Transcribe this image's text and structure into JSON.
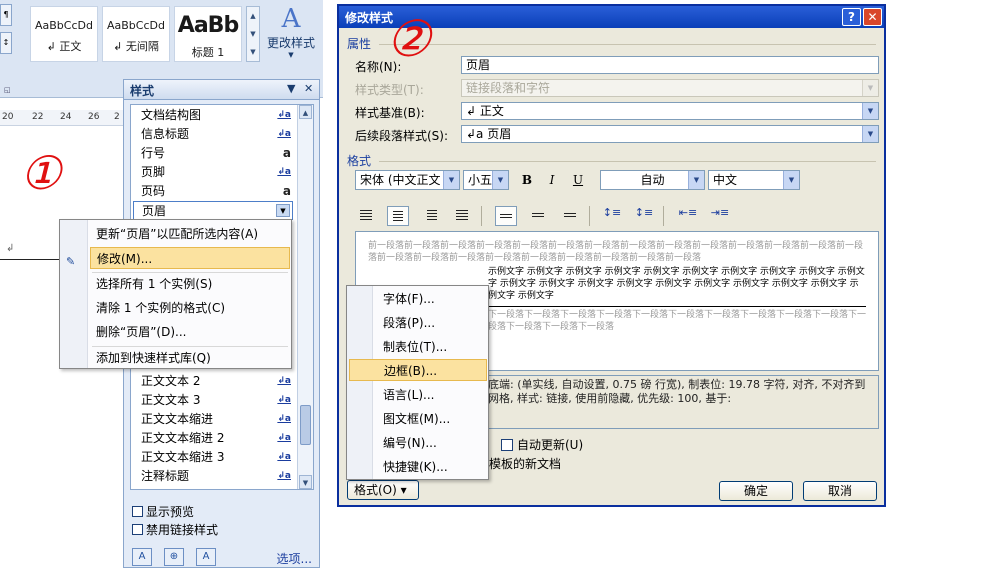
{
  "ribbon": {
    "gallery": [
      {
        "sample": "AaBbCcDd",
        "name": "↲ 正文"
      },
      {
        "sample": "AaBbCcDd",
        "name": "↲ 无间隔"
      },
      {
        "sample": "AaBb",
        "name": "标题 1"
      }
    ],
    "change_styles": "更改样式",
    "ruler_ticks": [
      "20",
      "22",
      "24",
      "26",
      "2"
    ]
  },
  "annotations": {
    "one": "①",
    "two": "②"
  },
  "styles_pane": {
    "title": "样式",
    "items": [
      {
        "label": "文档结构图",
        "tag": "↲a"
      },
      {
        "label": "信息标题",
        "tag": "↲a"
      },
      {
        "label": "行号",
        "tag": "a"
      },
      {
        "label": "页脚",
        "tag": "↲a"
      },
      {
        "label": "页码",
        "tag": "a"
      },
      {
        "label": "页眉",
        "tag": ""
      },
      {
        "label": "正文文本 2",
        "tag": "↲a"
      },
      {
        "label": "正文文本 3",
        "tag": "↲a"
      },
      {
        "label": "正文文本缩进",
        "tag": "↲a"
      },
      {
        "label": "正文文本缩进 2",
        "tag": "↲a"
      },
      {
        "label": "正文文本缩进 3",
        "tag": "↲a"
      },
      {
        "label": "注释标题",
        "tag": "↲a"
      }
    ],
    "show_preview": "显示预览",
    "disable_linked": "禁用链接样式",
    "options": "选项..."
  },
  "context_menu": {
    "update": "更新“页眉”以匹配所选内容(A)",
    "modify": "修改(M)...",
    "select_all": "选择所有 1 个实例(S)",
    "clear": "清除 1 个实例的格式(C)",
    "delete": "删除“页眉”(D)...",
    "add_gallery": "添加到快速样式库(Q)"
  },
  "dialog": {
    "title": "修改样式",
    "section_props": "属性",
    "name_label": "名称(N):",
    "name_value": "页眉",
    "type_label": "样式类型(T):",
    "type_value": "链接段落和字符",
    "based_label": "样式基准(B):",
    "based_value": "↲ 正文",
    "next_label": "后续段落样式(S):",
    "next_value": "↲a 页眉",
    "section_format": "格式",
    "font": "宋体 (中文正文",
    "size": "小五",
    "bold": "B",
    "italic": "I",
    "underline": "U",
    "color": "自动",
    "lang": "中文",
    "preview_prev": "前一段落前一段落前一段落前一段落前一段落前一段落前一段落前一段落前一段落前一段落前一段落前一段落前一段落前一段落前一段落前一段落前一段落前一段落前一段落前一段落前一段落前一段落前一段落",
    "preview_sample": "示例文字 示例文字 示例文字 示例文字 示例文字 示例文字 示例文字 示例文字 示例文字 示例文字 示例文字 示例文字 示例文字 示例文字 示例文字 示例文字 示例文字 示例文字 示例文字 示例文字 示例文字",
    "preview_next": "下一段落下一段落下一段落下一段落下一段落下一段落下一段落下一段落下一段落下一段落下一段落下一段落下一段落下一段落",
    "desc": "底端: (单实线, 自动设置, 0.75 磅 行宽), 制表位: 19.78 字符, 对齐, 不对齐到网格, 样式: 链接, 使用前隐藏, 优先级: 100, 基于:",
    "auto_update": "自动更新(U)",
    "new_docs_tail": "模板的新文档",
    "format_button": "格式(O) ▾",
    "ok": "确定",
    "cancel": "取消"
  },
  "format_menu": {
    "items": [
      "字体(F)...",
      "段落(P)...",
      "制表位(T)...",
      "边框(B)...",
      "语言(L)...",
      "图文框(M)...",
      "编号(N)...",
      "快捷键(K)..."
    ]
  }
}
